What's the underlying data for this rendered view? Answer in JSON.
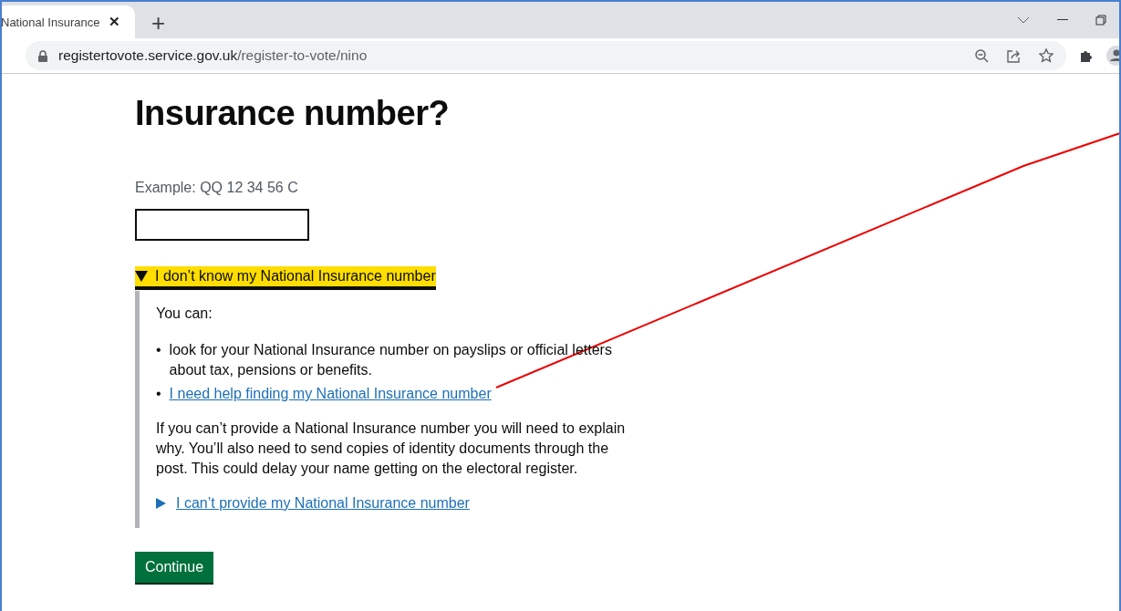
{
  "browser": {
    "tab_title": "National Insurance",
    "tab_close": "✕",
    "new_tab": "+",
    "url_host": "registertovote.service.gov.uk",
    "url_path": "/register-to-vote/nino"
  },
  "page": {
    "heading": "Insurance number?",
    "hint": "Example: QQ 12 34 56 C",
    "details": {
      "summary": "I don’t know my National Insurance number",
      "expanded": true,
      "intro": "You can:",
      "items": [
        {
          "kind": "text",
          "bullet": "•",
          "text": "look for your National Insurance number on payslips or official letters about tax, pensions or benefits."
        },
        {
          "kind": "link",
          "bullet": "•",
          "text": "I need help finding my National Insurance number"
        }
      ],
      "paragraph": "If you can’t provide a National Insurance number you will need to explain why. You’ll also need to send copies of identity documents through the post. This could delay your name getting on the electoral register.",
      "nested": {
        "summary": "I can’t provide my National Insurance number",
        "expanded": false
      }
    },
    "button": "Continue"
  }
}
